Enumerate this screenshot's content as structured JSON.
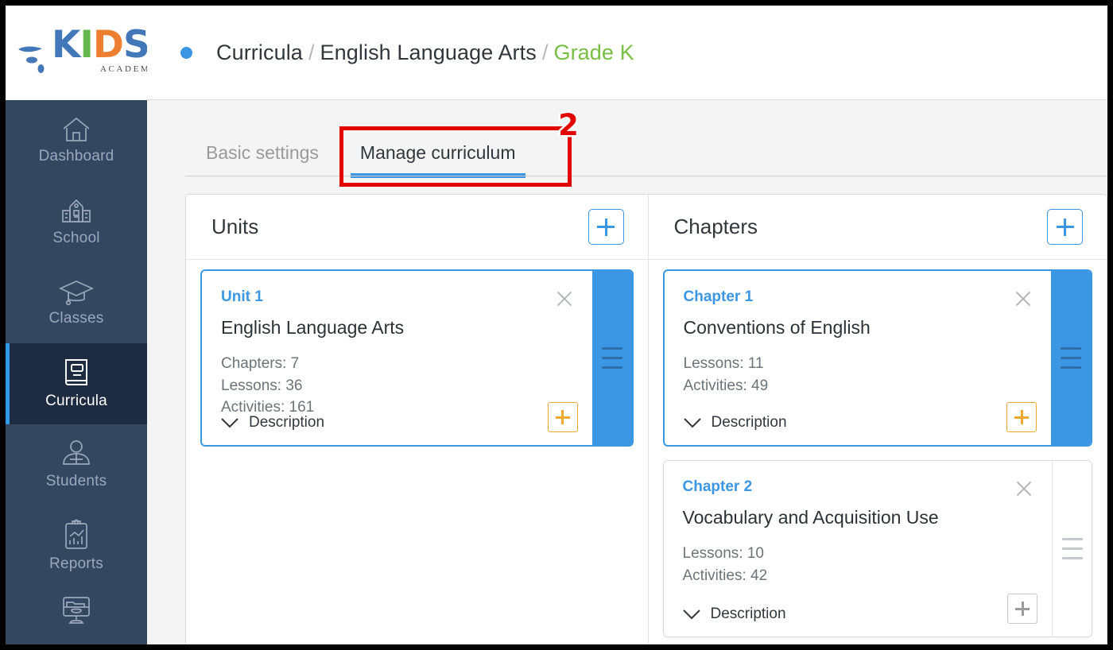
{
  "brand": {
    "logo_text_k": "K",
    "logo_text_i": "I",
    "logo_text_d": "D",
    "logo_text_s": "S",
    "logo_subtitle": "ACADEMY",
    "primary_blue": "#3b97e3",
    "accent_orange": "#f0a830",
    "accent_green": "#79be44",
    "sidebar_bg": "#344761",
    "sidebar_active_bg": "#1e2c42"
  },
  "sidebar": {
    "items": [
      {
        "label": "Dashboard",
        "icon": "home-icon",
        "active": false
      },
      {
        "label": "School",
        "icon": "school-icon",
        "active": false
      },
      {
        "label": "Classes",
        "icon": "graduation-cap-icon",
        "active": false
      },
      {
        "label": "Curricula",
        "icon": "book-icon",
        "active": true
      },
      {
        "label": "Students",
        "icon": "user-group-icon",
        "active": false
      },
      {
        "label": "Reports",
        "icon": "report-chart-icon",
        "active": false
      },
      {
        "label": "",
        "icon": "desktop-folder-icon",
        "active": false
      }
    ]
  },
  "header": {
    "breadcrumb": {
      "root": "Curricula",
      "separator": "/",
      "middle": "English Language Arts",
      "current": "Grade K"
    }
  },
  "tabs": [
    {
      "label": "Basic settings",
      "active": false
    },
    {
      "label": "Manage curriculum",
      "active": true
    }
  ],
  "annotation": {
    "number": "2",
    "color": "#e30000",
    "targets": "Manage curriculum tab"
  },
  "panels": {
    "units": {
      "title": "Units",
      "add_button": "add-unit",
      "cards": [
        {
          "kicker": "Unit 1",
          "title": "English Language Arts",
          "stats": [
            "Chapters: 7",
            "Lessons: 36",
            "Activities: 161"
          ],
          "description_label": "Description",
          "selected": true,
          "add_button_style": "orange"
        }
      ]
    },
    "chapters": {
      "title": "Chapters",
      "add_button": "add-chapter",
      "cards": [
        {
          "kicker": "Chapter 1",
          "title": "Conventions of English",
          "stats": [
            "Lessons: 11",
            "Activities: 49"
          ],
          "description_label": "Description",
          "selected": true,
          "add_button_style": "orange"
        },
        {
          "kicker": "Chapter 2",
          "title": "Vocabulary and Acquisition Use",
          "stats": [
            "Lessons: 10",
            "Activities: 42"
          ],
          "description_label": "Description",
          "selected": false,
          "add_button_style": "grey"
        }
      ]
    }
  }
}
